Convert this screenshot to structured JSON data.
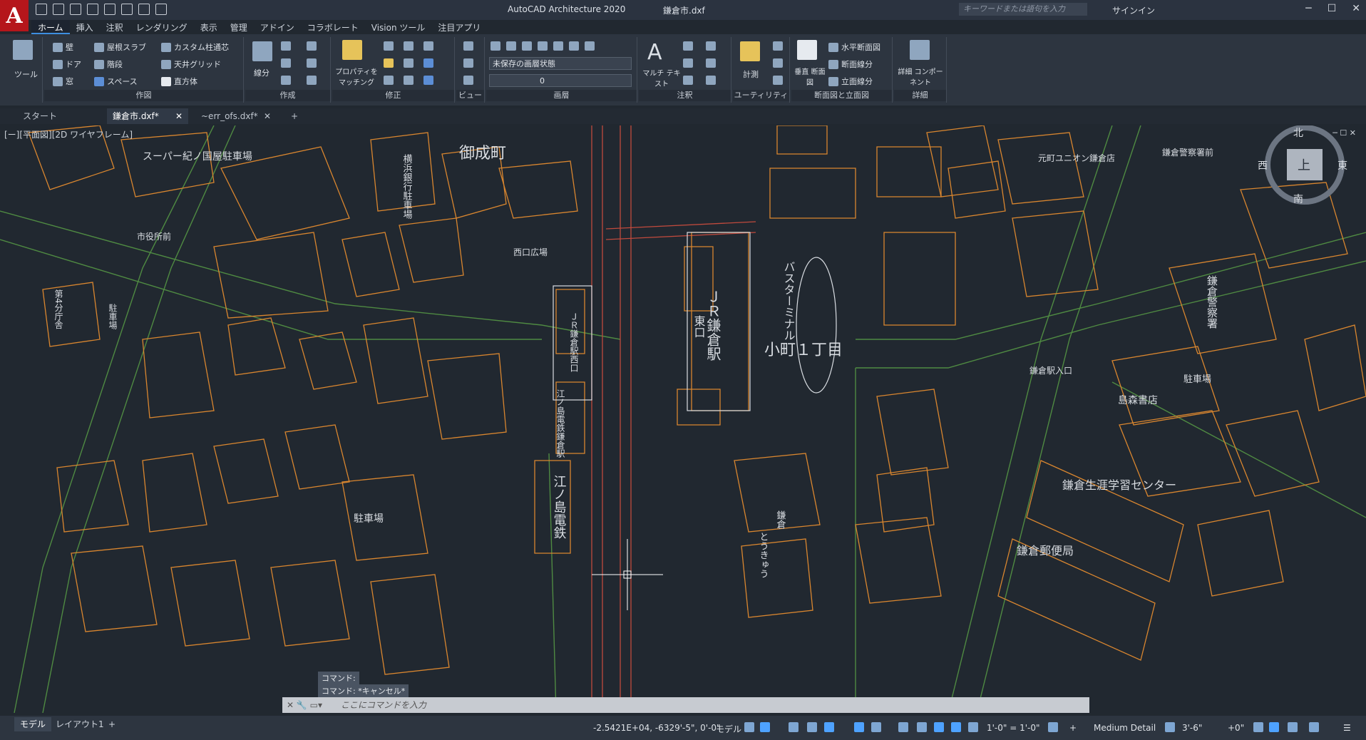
{
  "app": {
    "logo_letter": "A",
    "title": "AutoCAD Architecture 2020",
    "document": "鎌倉市.dxf",
    "search_placeholder": "キーワードまたは語句を入力",
    "signin": "サインイン"
  },
  "menu_tabs": [
    "ホーム",
    "挿入",
    "注釈",
    "レンダリング",
    "表示",
    "管理",
    "アドイン",
    "コラボレート",
    "Vision ツール",
    "注目アプリ"
  ],
  "ribbon": {
    "tools_label": "ツール",
    "build": {
      "title": "作図",
      "items": [
        "壁",
        "屋根スラブ",
        "カスタム柱通芯",
        "ドア",
        "階段",
        "天井グリッド",
        "窓",
        "スペース",
        "直方体"
      ]
    },
    "draw": {
      "title": "作成",
      "polyline": "線分"
    },
    "modify": {
      "title": "修正",
      "properties": "プロパティを マッチング"
    },
    "view": {
      "title": "ビュー"
    },
    "layers": {
      "title": "画層",
      "state": "未保存の画層状態",
      "layer": "0"
    },
    "annotation": {
      "title": "注釈",
      "mtext": "マルチ テキスト"
    },
    "utilities": {
      "title": "ユーティリティ",
      "measure": "計測"
    },
    "sections": {
      "title": "断面図と立面図",
      "vertical": "垂直 断面図",
      "items": [
        "水平断面図",
        "断面線分",
        "立面線分"
      ]
    },
    "details": {
      "title": "詳細",
      "component": "詳細 コンポーネント"
    }
  },
  "file_tabs": [
    {
      "label": "スタート"
    },
    {
      "label": "鎌倉市.dxf*"
    },
    {
      "label": "~err_ofs.dxf*"
    }
  ],
  "viewport": {
    "label": "[ー][平面図][2D ワイヤフレーム]",
    "viewcube": {
      "north": "北",
      "south": "南",
      "east": "東",
      "west": "西",
      "top": "上"
    }
  },
  "map_labels": {
    "area": "御成町",
    "area2": "小町１丁目",
    "jr_station": "ＪＲ鎌倉駅",
    "east_exit": "東口",
    "bus_terminal": "バスターミナル",
    "west_square": "西口広場",
    "jr_west": "ＪＲ鎌倉駅西口",
    "enoden_station": "江ノ島電鉄鎌倉駅",
    "enoden": "江ノ島電鉄",
    "supermarket": "スーパー紀ノ国屋駐車場",
    "bank": "横浜銀行駐車場",
    "cityhall_front": "市役所前",
    "parking": "駐車場",
    "parking2": "駐車場",
    "parking3": "駐車場",
    "police": "鎌倉警察署",
    "bookstore": "島森書店",
    "learning_center": "鎌倉生涯学習センター",
    "post_office": "鎌倉郵便局",
    "station_entrance": "鎌倉駅入口",
    "kamakura_police": "鎌倉警察署前",
    "union": "元町ユニオン鎌倉店",
    "toukyu": "とうきゅう",
    "kamakura_small": "鎌倉",
    "branch": "第4分庁舎"
  },
  "command": {
    "history": [
      "コマンド:",
      "コマンド: *キャンセル*"
    ],
    "placeholder": "ここにコマンドを入力"
  },
  "status": {
    "model_tab": "モデル",
    "layout_tab": "レイアウト1",
    "coords": "-2.5421E+04, -6329'-5\", 0'-0\"",
    "space": "モデル",
    "scale": "1'-0\" = 1'-0\"",
    "detail": "Medium Detail",
    "elevation": "3'-6\"",
    "offset": "+0\""
  },
  "colors": {
    "background": "#212830",
    "building": "#d9862f",
    "road": "#4f8a42",
    "rail": "#c04a3d",
    "text": "#d9dde2"
  }
}
